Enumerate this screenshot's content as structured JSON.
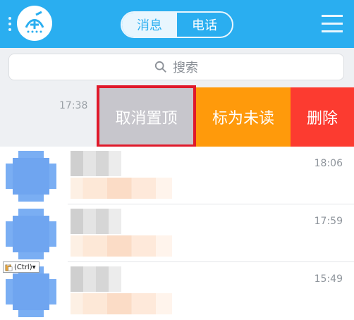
{
  "header": {
    "tabs": [
      {
        "label": "消息",
        "active": true
      },
      {
        "label": "电话",
        "active": false
      }
    ]
  },
  "search": {
    "placeholder": "搜索"
  },
  "swiped_row": {
    "time": "17:38",
    "actions": {
      "unpin": "取消置顶",
      "mark_unread": "标为未读",
      "delete": "删除"
    }
  },
  "conversations": [
    {
      "time": "18:06"
    },
    {
      "time": "17:59"
    },
    {
      "time": "15:49"
    }
  ],
  "paste_tooltip": {
    "label": "(Ctrl)▾"
  },
  "colors": {
    "header": "#2aaef0",
    "unpin": "#c7c6cc",
    "mark_unread": "#ff9a0b",
    "delete": "#fc3b30",
    "highlight_border": "#e0192a"
  }
}
